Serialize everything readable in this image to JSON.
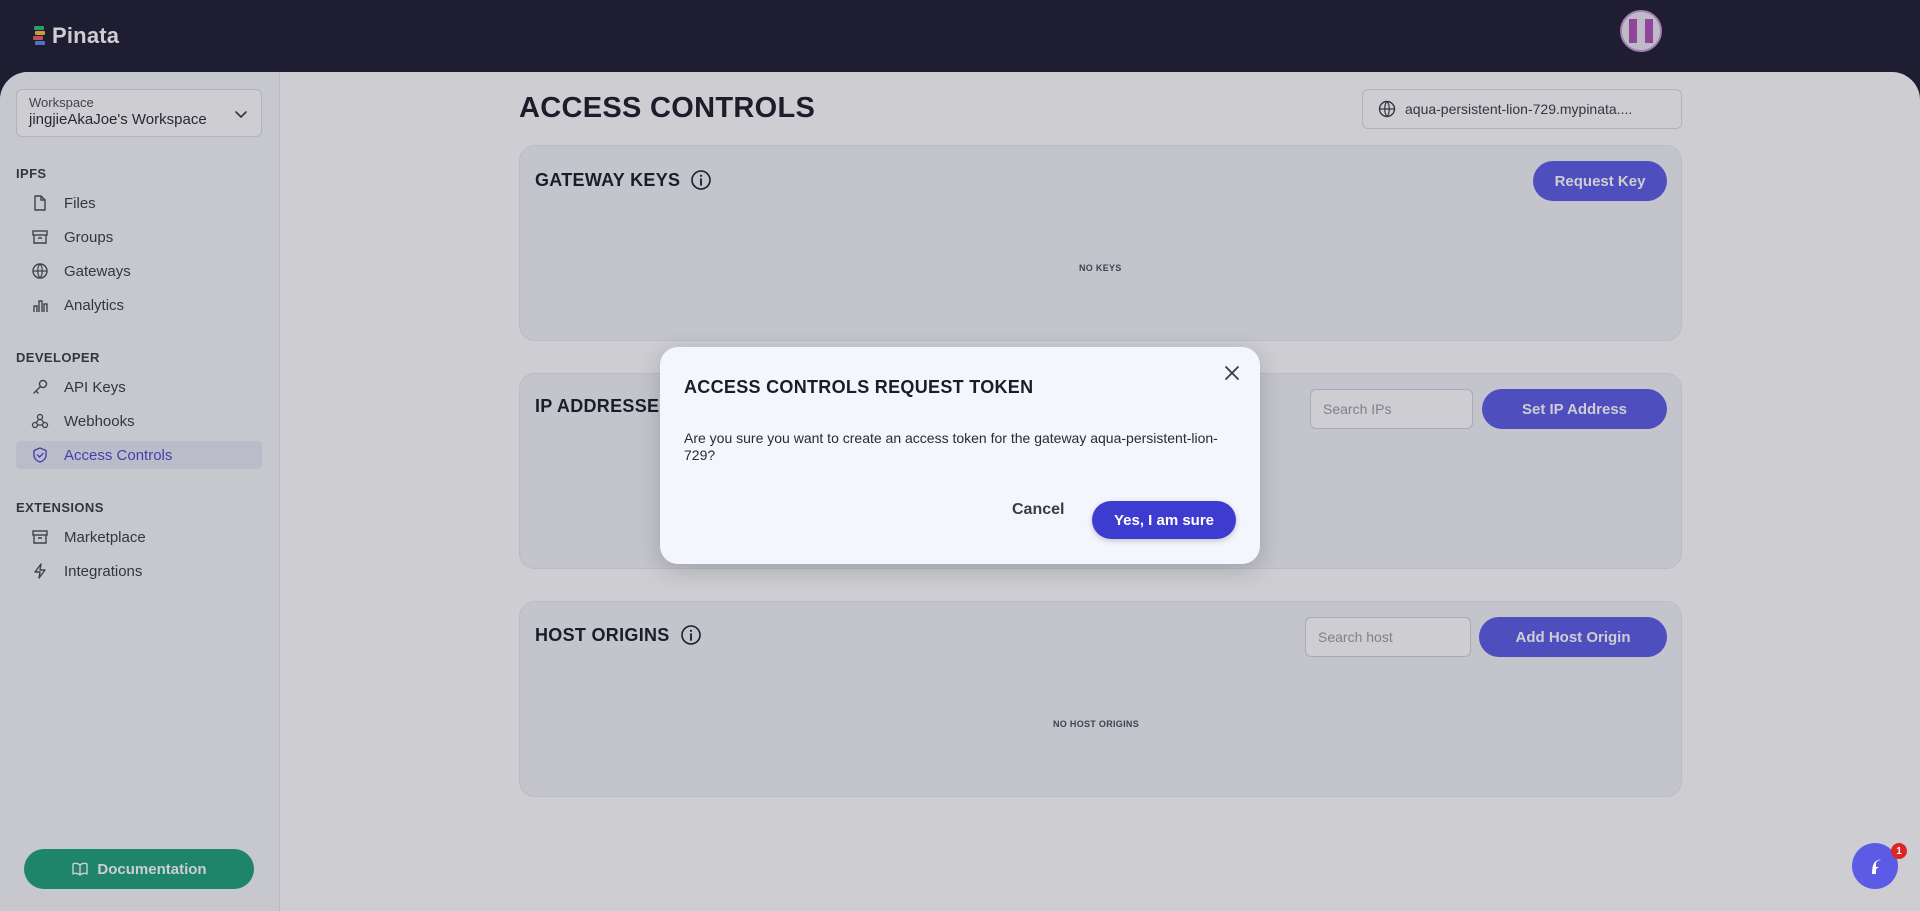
{
  "app": {
    "name": "Pinata"
  },
  "sidebar": {
    "workspace": {
      "label": "Workspace",
      "name": "jingjieAkaJoe's Workspace"
    },
    "sections": [
      {
        "title": "IPFS",
        "items": [
          {
            "label": "Files",
            "icon": "file-icon"
          },
          {
            "label": "Groups",
            "icon": "archive-icon"
          },
          {
            "label": "Gateways",
            "icon": "globe-icon"
          },
          {
            "label": "Analytics",
            "icon": "bar-chart-icon"
          }
        ]
      },
      {
        "title": "DEVELOPER",
        "items": [
          {
            "label": "API Keys",
            "icon": "key-icon"
          },
          {
            "label": "Webhooks",
            "icon": "webhook-icon"
          },
          {
            "label": "Access Controls",
            "icon": "shield-check-icon",
            "active": true
          }
        ]
      },
      {
        "title": "EXTENSIONS",
        "items": [
          {
            "label": "Marketplace",
            "icon": "archive-icon"
          },
          {
            "label": "Integrations",
            "icon": "bolt-icon"
          }
        ]
      }
    ],
    "documentation_label": "Documentation"
  },
  "main": {
    "title": "ACCESS CONTROLS",
    "gateway": "aqua-persistent-lion-729.mypinata....",
    "gateway_keys": {
      "title": "GATEWAY KEYS",
      "button": "Request Key",
      "empty": "NO KEYS"
    },
    "ip_addresses": {
      "title": "IP ADDRESSES",
      "search_placeholder": "Search IPs",
      "button": "Set IP Address"
    },
    "host_origins": {
      "title": "HOST ORIGINS",
      "search_placeholder": "Search host",
      "button": "Add Host Origin",
      "empty": "NO HOST ORIGINS"
    }
  },
  "modal": {
    "title": "ACCESS CONTROLS REQUEST TOKEN",
    "body": "Are you sure you want to create an access token for the gateway aqua-persistent-lion-729?",
    "cancel": "Cancel",
    "confirm": "Yes, I am sure"
  },
  "chat": {
    "badge": "1"
  },
  "colors": {
    "primary": "#5b5be6",
    "confirm": "#3e3bd1",
    "docs": "#1ea27a",
    "topbar": "#1f1d33",
    "active": "#4b4bd0"
  }
}
